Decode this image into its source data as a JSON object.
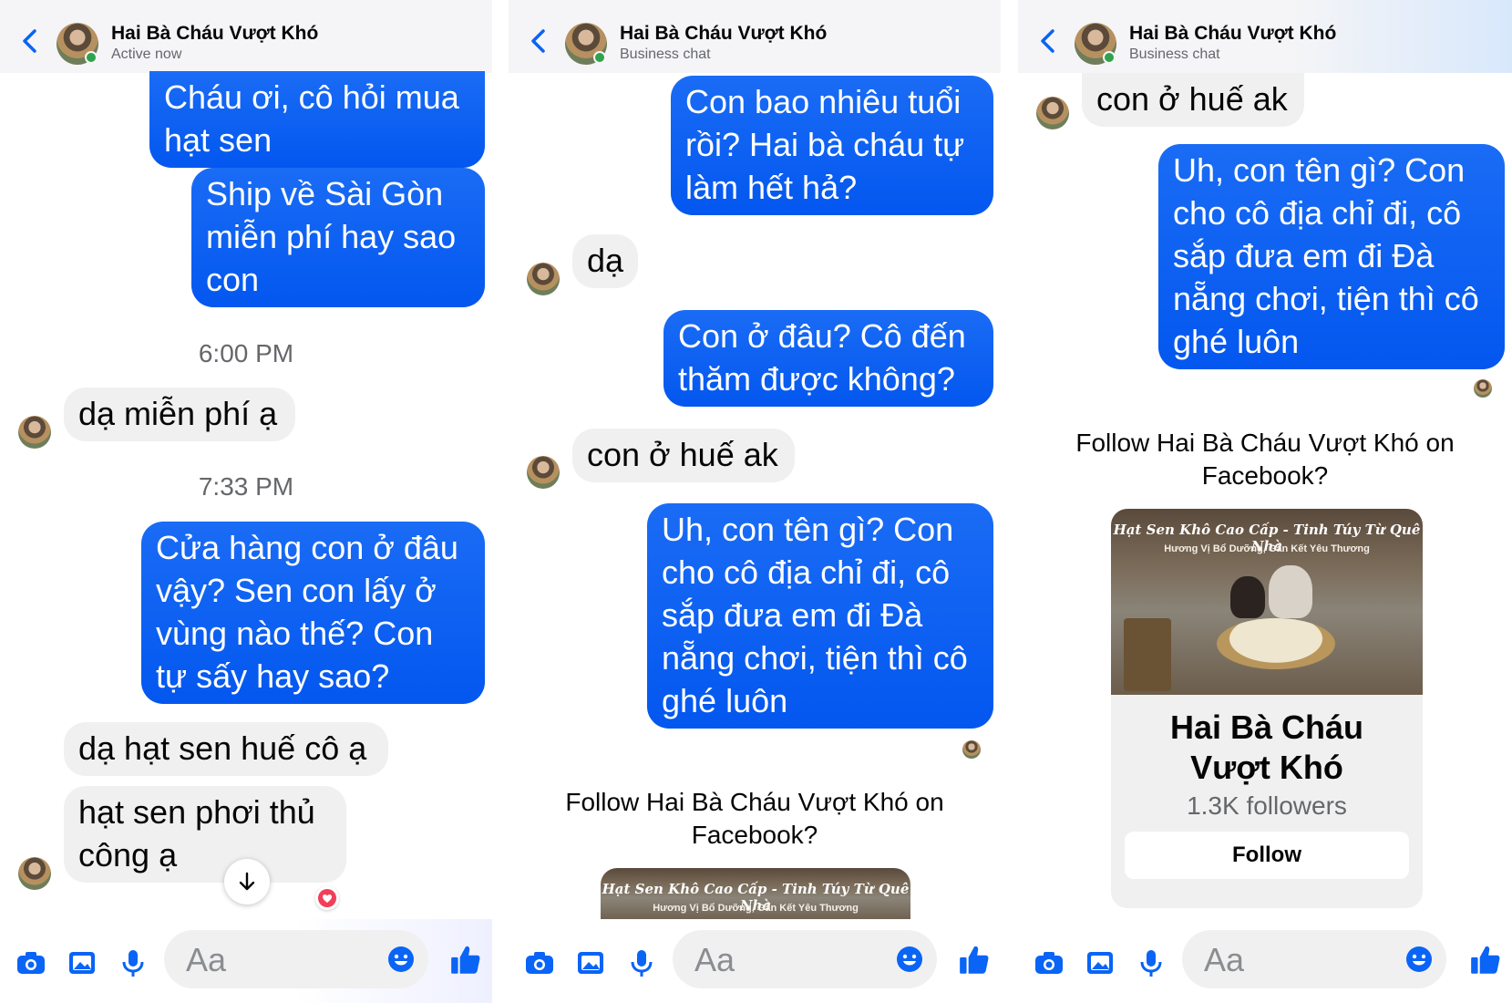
{
  "contact": {
    "name": "Hai Bà Cháu Vượt Khó",
    "status_active": "Active now",
    "status_business": "Business chat"
  },
  "panel1": {
    "msg1": "Cháu ơi, cô hỏi mua\nhạt sen",
    "msg2": "Ship về Sài Gòn\nmiễn phí hay sao\ncon",
    "time1": "6:00 PM",
    "msg3": "dạ miễn phí ạ",
    "time2": "7:33 PM",
    "msg4": "Cửa hàng con ở đâu\nvậy? Sen con lấy ở\nvùng nào thế? Con\ntự sấy hay sao?",
    "msg5": "dạ hạt sen huế cô ạ",
    "msg6": "hạt sen phơi thủ\ncông ạ"
  },
  "panel2": {
    "msg1": "Con bao nhiêu tuổi\nrồi? Hai bà cháu tự\nlàm hết hả?",
    "msg2": "dạ",
    "msg3": "Con ở đâu? Cô đến\nthăm được không?",
    "msg4": "con ở huế ak",
    "msg5": "Uh, con tên gì? Con\ncho cô địa chỉ đi, cô\nsắp đưa em đi Đà\nnẵng chơi, tiện thì cô\nghé luôn"
  },
  "panel3": {
    "msg1": "con ở huế ak",
    "msg2": "Uh, con tên gì? Con\ncho cô địa chỉ đi, cô\nsắp đưa em đi Đà\nnẵng chơi, tiện thì cô\nghé luôn"
  },
  "follow_prompt": "Follow Hai Bà Cháu Vượt Khó on\nFacebook?",
  "page_card": {
    "banner_title": "Hạt Sen Khô Cao Cấp - Tinh Túy Từ Quê Nhà",
    "banner_subtitle": "Hương Vị Bổ Dưỡng, Gắn Kết Yêu Thương",
    "name": "Hai Bà Cháu\nVượt Khó",
    "followers": "1.3K followers",
    "follow_label": "Follow"
  },
  "composer": {
    "placeholder": "Aa"
  },
  "icons": {
    "back": "chevron-left-icon",
    "camera": "camera-icon",
    "gallery": "image-icon",
    "mic": "microphone-icon",
    "emoji": "emoji-icon",
    "like": "thumbs-up-icon",
    "scroll": "arrow-down-icon",
    "reaction": "heart-icon"
  },
  "colors": {
    "accent": "#0a64f5",
    "online": "#31a24c",
    "reaction": "#f33e58"
  }
}
